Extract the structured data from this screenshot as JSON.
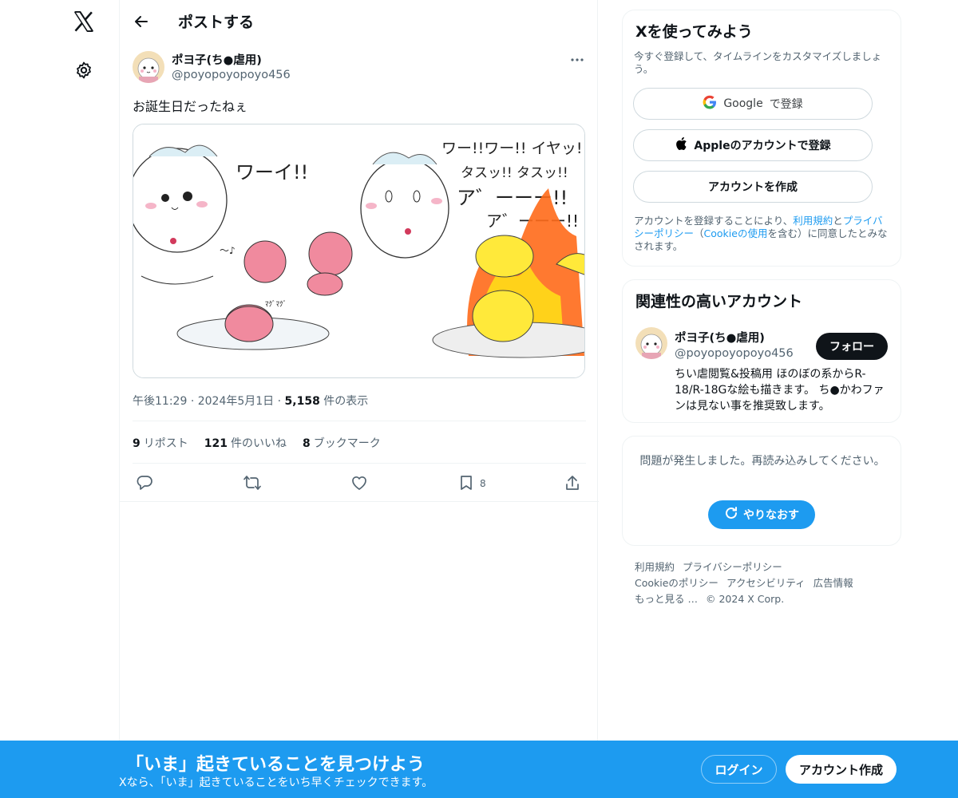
{
  "nav": {
    "logo_icon": "x-logo-icon",
    "settings_icon": "gear-icon"
  },
  "header": {
    "title": "ポストする"
  },
  "post": {
    "display_name": "ポヨ子(ち●虐用)",
    "handle": "@poyopoyopoyo456",
    "text": "お誕生日だったねぇ",
    "image_texts": {
      "t1": "ワーイ!!",
      "t2": "ワー!!ワー!! イヤッ!!ヤ",
      "t3": "タスッ!! タスッ!!",
      "t4": "ア゛ーーー!!",
      "t5": "ア゛ーーー!!",
      "t6": "〜♪",
      "t7": "ﾏｸﾞﾏｸﾞ"
    },
    "time": "午後11:29",
    "date": "2024年5月1日",
    "views": "5,158",
    "views_label": "件の表示",
    "reposts": "9",
    "reposts_label": "リポスト",
    "likes": "121",
    "likes_label": "件のいいね",
    "bookmarks": "8",
    "bookmarks_label": "ブックマーク",
    "bookmark_count": "8"
  },
  "signup_card": {
    "title": "Xを使ってみよう",
    "subtitle": "今すぐ登録して、タイムラインをカスタマイズしましょう。",
    "google_brand": "Google",
    "google_label": "で登録",
    "apple_label": "Appleのアカウントで登録",
    "create_label": "アカウントを作成",
    "terms_1": "アカウントを登録することにより、",
    "terms_link1": "利用規約",
    "terms_2": "と",
    "terms_link2": "プライバシーポリシー",
    "terms_3": "（",
    "terms_link3": "Cookieの使用",
    "terms_4": "を含む）に同意したとみなされます。"
  },
  "relevant": {
    "title": "関連性の高いアカウント",
    "name": "ポヨ子(ち●虐用)",
    "handle": "@poyopoyopoyo456",
    "follow_label": "フォロー",
    "bio": "ちい虐閲覧&投稿用 ほのぼの系からR-18/R-18Gな絵も描きます。 ち●かわファンは見ない事を推奨致します。"
  },
  "error_card": {
    "message": "問題が発生しました。再読み込みしてください。",
    "retry_label": "やりなおす"
  },
  "footer": {
    "links": [
      "利用規約",
      "プライバシーポリシー",
      "Cookieのポリシー",
      "アクセシビリティ",
      "広告情報",
      "もっと見る …"
    ],
    "copyright": "© 2024 X Corp."
  },
  "banner": {
    "title": "「いま」起きていることを見つけよう",
    "subtitle": "Xなら、「いま」起きていることをいち早くチェックできます。",
    "login_label": "ログイン",
    "signup_label": "アカウント作成"
  },
  "colors": {
    "accent": "#1d9bf0",
    "text": "#0f1419",
    "muted": "#536471",
    "border": "#eff3f4"
  }
}
